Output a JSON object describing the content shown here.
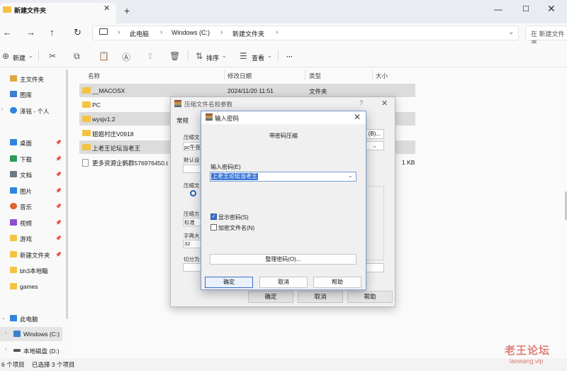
{
  "tab": {
    "title": "新建文件夹"
  },
  "address": {
    "crumbs": [
      "此电脑",
      "Windows (C:)",
      "新建文件夹"
    ],
    "search_placeholder": "在 新建文件夹"
  },
  "toolbar": {
    "new_label": "新建",
    "sort_label": "排序",
    "view_label": "查看",
    "more_label": "···"
  },
  "sidebar": {
    "items": [
      {
        "label": "主文件夹"
      },
      {
        "label": "图库"
      },
      {
        "label": "泽铭 - 个人"
      },
      {
        "label": "桌面"
      },
      {
        "label": "下载"
      },
      {
        "label": "文档"
      },
      {
        "label": "图片"
      },
      {
        "label": "音乐"
      },
      {
        "label": "视频"
      },
      {
        "label": "游戏"
      },
      {
        "label": "新建文件夹"
      },
      {
        "label": "bh3本地瞄"
      },
      {
        "label": "games"
      },
      {
        "label": "此电脑"
      },
      {
        "label": "Windows (C:)"
      },
      {
        "label": "本地磁盘 (D:)"
      }
    ]
  },
  "file_list": {
    "columns": [
      "名称",
      "修改日期",
      "类型",
      "大小"
    ],
    "rows": [
      {
        "name": "__MACOSX",
        "date": "2024/11/20 11:51",
        "type": "文件夹",
        "size": ""
      },
      {
        "name": "PC",
        "date": "",
        "type": "",
        "size": ""
      },
      {
        "name": "wysjv1.2",
        "date": "",
        "type": "",
        "size": ""
      },
      {
        "name": "姐姐村庄V0918",
        "date": "",
        "type": "",
        "size": ""
      },
      {
        "name": "上老王论坛当老王",
        "date": "",
        "type": "",
        "size": ""
      },
      {
        "name": "更多资源企鹅群576976450.t",
        "date": "",
        "type": "",
        "size": "1 KB"
      }
    ]
  },
  "status": {
    "count": "6 个项目",
    "selected": "已选择 3 个项目"
  },
  "back_dialog": {
    "title": "压缩文件名和参数",
    "help": "?",
    "tab_general": "常规",
    "labels": [
      "压缩文",
      "默认设",
      "压缩文",
      "压缩方",
      "字典大",
      "切分为"
    ],
    "archive_name": "pc午夜",
    "method_value": "标准",
    "dict_value": "32",
    "browse_label": "(B)...",
    "ok": "确定",
    "cancel": "取消",
    "help_btn": "帮助"
  },
  "password_dialog": {
    "title": "输入密码",
    "subtitle": "带密码压缩",
    "field_label": "输入密码(E)",
    "password_value": "上老王论坛当老王",
    "show_password": "显示密码(S)",
    "encrypt_names": "加密文件名(N)",
    "organize": "整理密码(O)...",
    "ok": "确定",
    "cancel": "取消",
    "help": "帮助"
  },
  "watermark": {
    "main": "老王论坛",
    "sub": "laowang.vip"
  }
}
